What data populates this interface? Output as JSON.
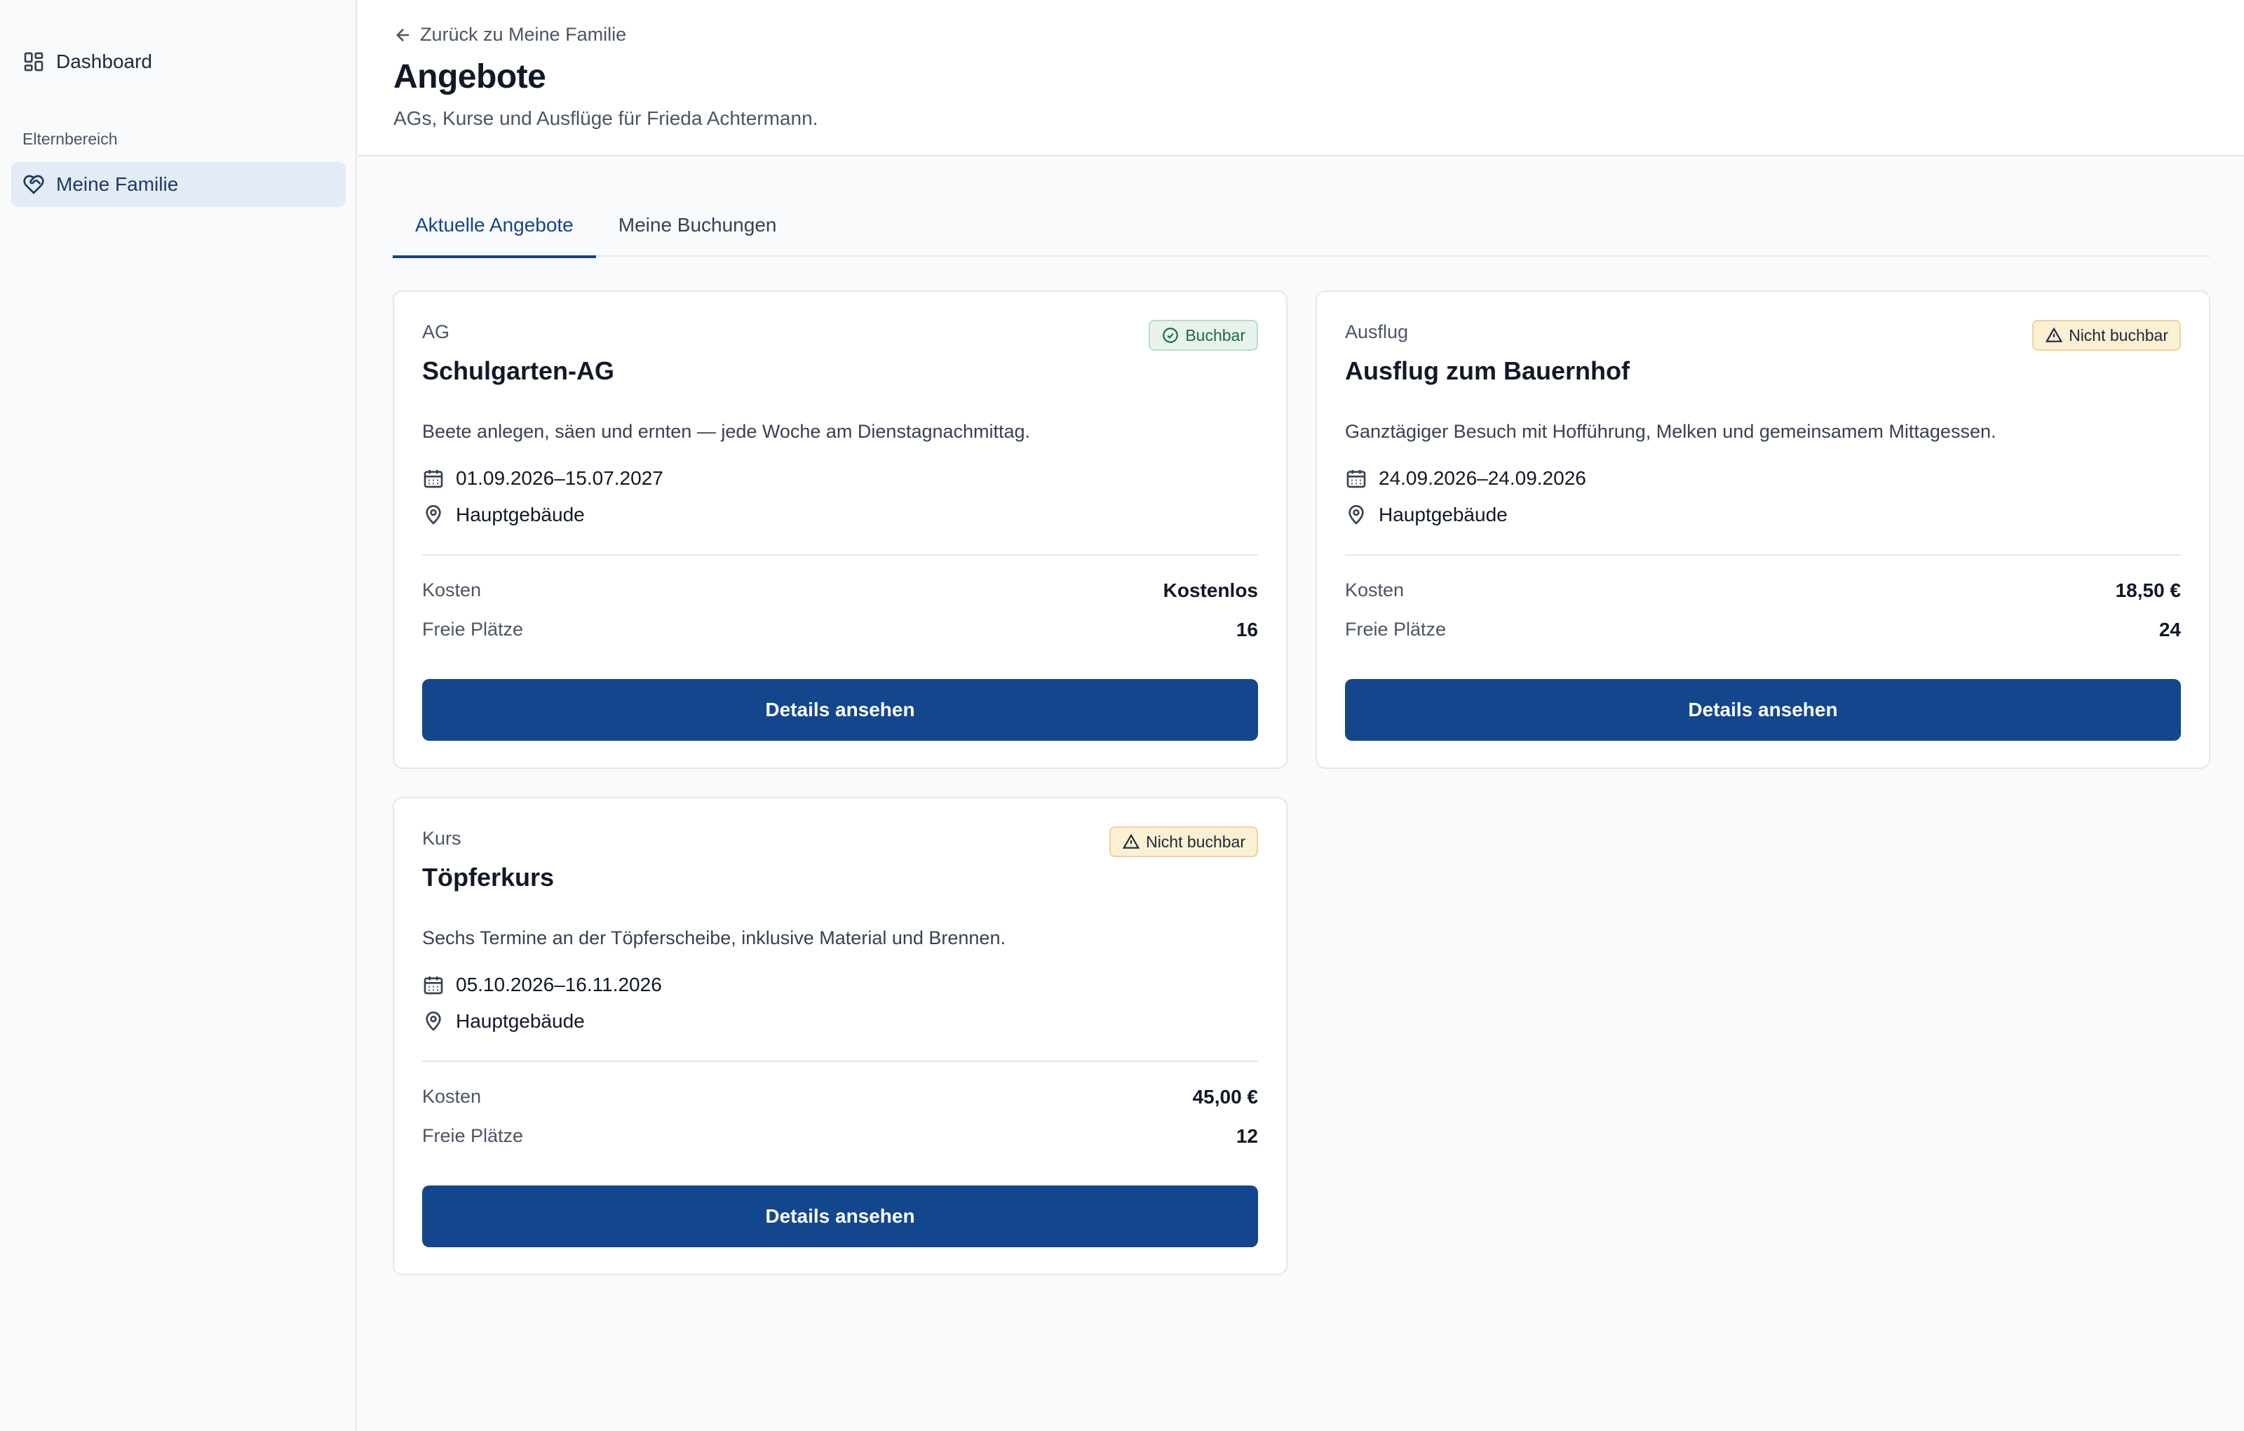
{
  "sidebar": {
    "items": [
      {
        "label": "Dashboard",
        "icon": "dashboard-icon"
      },
      {
        "label": "Meine Familie",
        "icon": "heart-handshake-icon",
        "active": true
      }
    ],
    "section_label": "Elternbereich"
  },
  "header": {
    "back_label": "Zurück zu Meine Familie",
    "title": "Angebote",
    "subtitle": "AGs, Kurse und Ausflüge für Frieda Achtermann."
  },
  "tabs": [
    {
      "label": "Aktuelle Angebote",
      "active": true
    },
    {
      "label": "Meine Buchungen",
      "active": false
    }
  ],
  "offers": [
    {
      "type": "AG",
      "title": "Schulgarten-AG",
      "status": "Buchbar",
      "status_kind": "ok",
      "description": "Beete anlegen, säen und ernten — jede Woche am Dienstagnachmittag.",
      "date_range": "01.09.2026–15.07.2027",
      "location": "Hauptgebäude",
      "cost_label": "Kosten",
      "cost": "Kostenlos",
      "slots_label": "Freie Plätze",
      "slots": "16",
      "button_label": "Details ansehen"
    },
    {
      "type": "Ausflug",
      "title": "Ausflug zum Bauernhof",
      "status": "Nicht buchbar",
      "status_kind": "warn",
      "description": "Ganztägiger Besuch mit Hofführung, Melken und gemeinsamem Mittagessen.",
      "date_range": "24.09.2026–24.09.2026",
      "location": "Hauptgebäude",
      "cost_label": "Kosten",
      "cost": "18,50 €",
      "slots_label": "Freie Plätze",
      "slots": "24",
      "button_label": "Details ansehen"
    },
    {
      "type": "Kurs",
      "title": "Töpferkurs",
      "status": "Nicht buchbar",
      "status_kind": "warn",
      "description": "Sechs Termine an der Töpferscheibe, inklusive Material und Brennen.",
      "date_range": "05.10.2026–16.11.2026",
      "location": "Hauptgebäude",
      "cost_label": "Kosten",
      "cost": "45,00 €",
      "slots_label": "Freie Plätze",
      "slots": "12",
      "button_label": "Details ansehen"
    }
  ],
  "colors": {
    "primary": "#13468c",
    "active_nav_bg": "#e2ebf6",
    "badge_ok_bg": "#e7f3ec",
    "badge_warn_bg": "#fbf0d4"
  }
}
